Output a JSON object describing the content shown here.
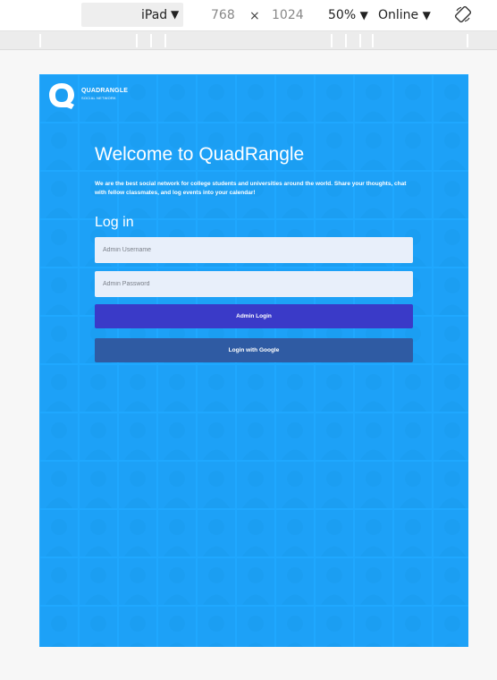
{
  "toolbar": {
    "device": "iPad",
    "width": "768",
    "times": "×",
    "height": "1024",
    "zoom": "50%",
    "network": "Online"
  },
  "app": {
    "logo_letter": "Q",
    "brand_name": "QUADRANGLE",
    "brand_tagline": "SOCIAL NETWORK",
    "welcome_title": "Welcome to QuadRangle",
    "intro_text": "We are the best social network for college students and universities around the world. Share your thoughts, chat with fellow classmates, and log events into your calendar!",
    "login_heading": "Log in",
    "username_placeholder": "Admin Username",
    "password_placeholder": "Admin Password",
    "admin_login_label": "Admin Login",
    "google_login_label": "Login with Google"
  },
  "colors": {
    "viewport_bg": "#1fa8ff",
    "admin_button": "#3a3ac8",
    "google_button": "#2f5ba3",
    "input_bg": "#e8effa"
  },
  "icons": [
    "caret-down-icon",
    "rotate-icon",
    "quadrangle-logo-icon"
  ]
}
